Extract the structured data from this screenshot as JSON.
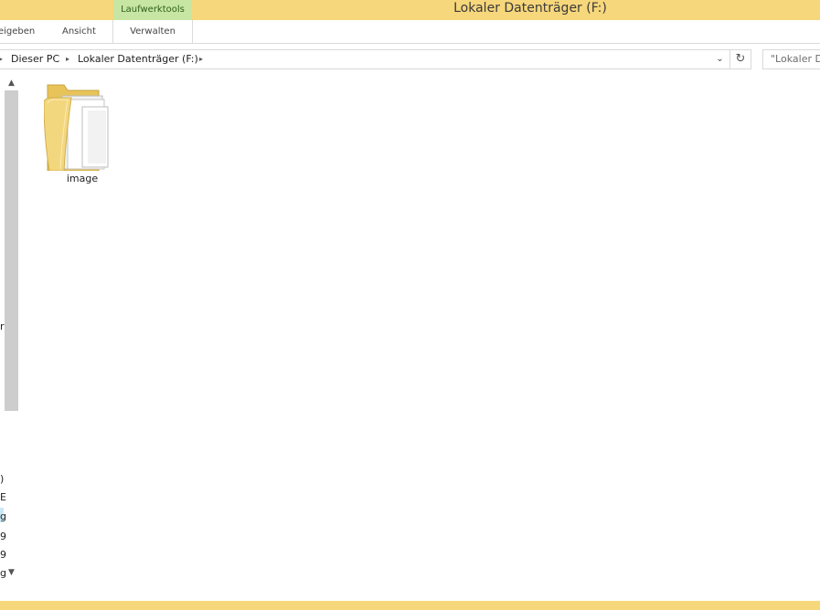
{
  "titlebar": {
    "context_tab": "Laufwerktools",
    "window_title": "Lokaler Datenträger (F:)"
  },
  "ribbon": {
    "tabs": [
      "eigeben",
      "Ansicht",
      "Verwalten"
    ]
  },
  "address": {
    "crumbs": [
      "Dieser PC",
      "Lokaler Datenträger (F:)"
    ],
    "search_placeholder": "\"Lokaler D"
  },
  "navpane": {
    "fragments": [
      "r",
      ")",
      "E",
      "g",
      "9",
      "9",
      "g"
    ]
  },
  "content": {
    "items": [
      {
        "name": "image",
        "type": "folder-icon"
      }
    ]
  },
  "colors": {
    "title_bar": "#f6d77b",
    "context_tab": "#c7e6a3",
    "nav_highlight": "#cbe8f6"
  }
}
